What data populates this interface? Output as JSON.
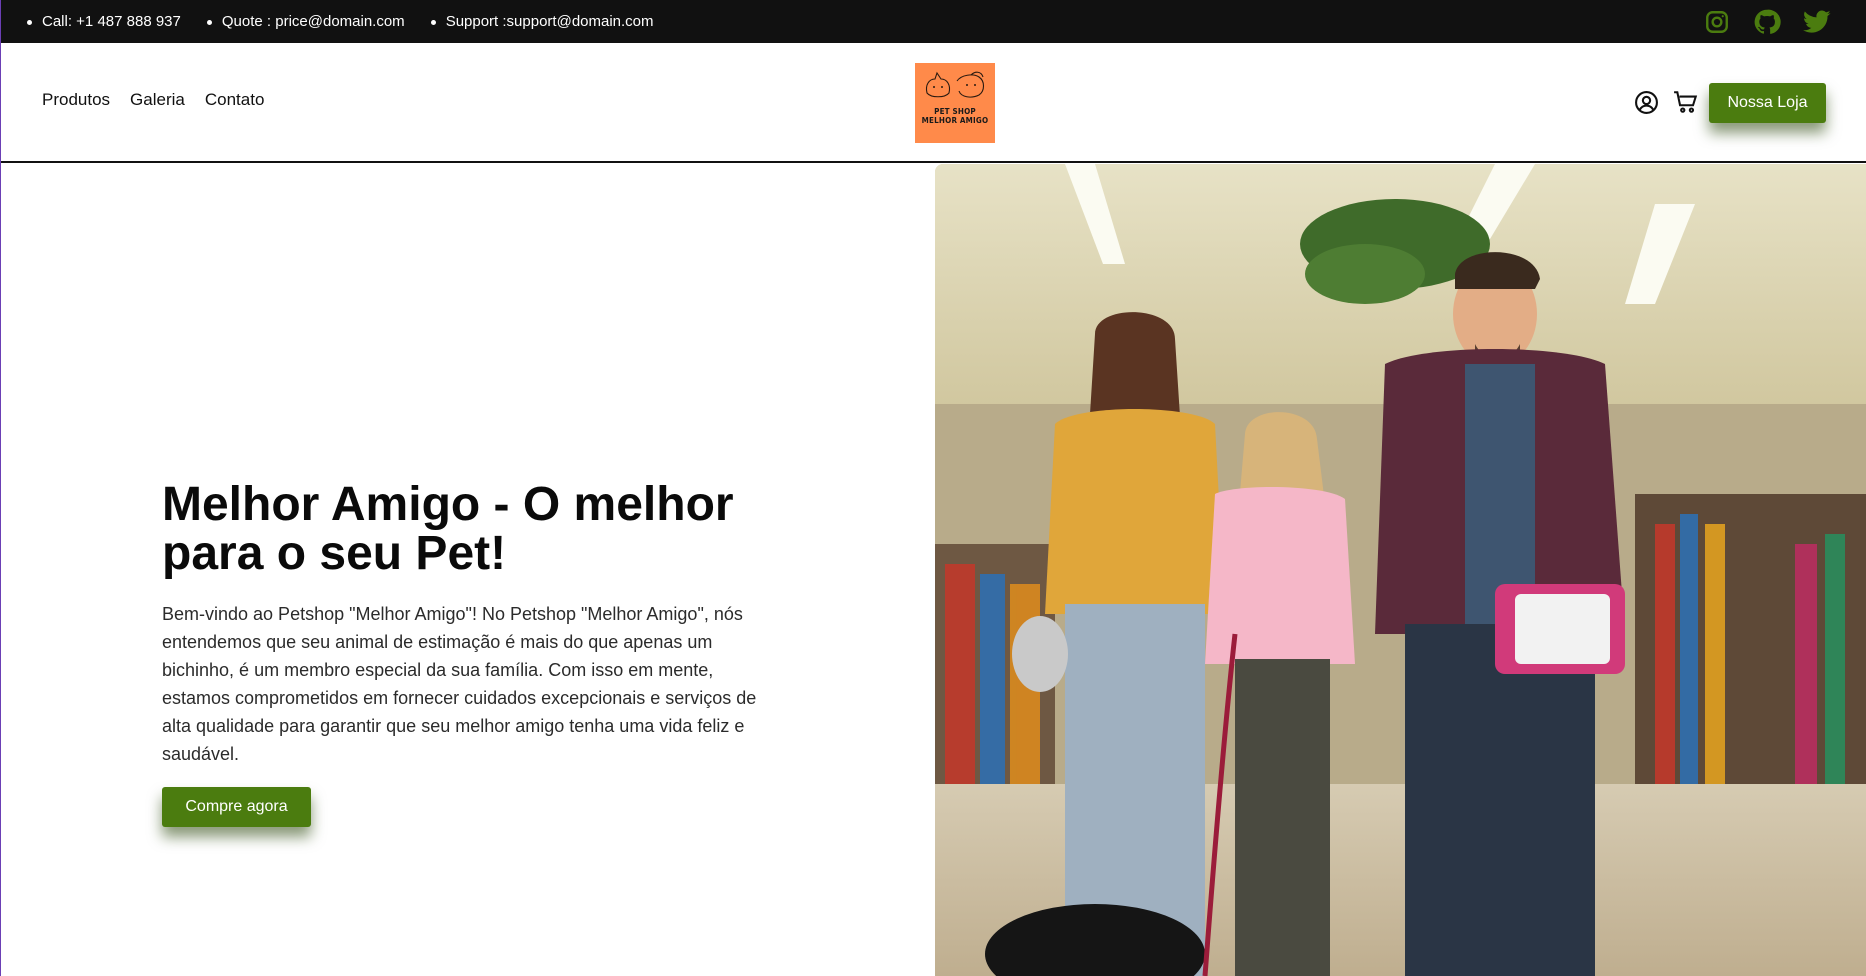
{
  "topbar": {
    "call": "Call: +1 487 888 937",
    "quote": "Quote : price@domain.com",
    "support": "Support :support@domain.com",
    "social": [
      "instagram-icon",
      "github-icon",
      "twitter-icon"
    ],
    "social_color": "#4b7c0f"
  },
  "nav": {
    "items": [
      "Produtos",
      "Galeria",
      "Contato"
    ]
  },
  "logo": {
    "line1": "PET SHOP",
    "line2": "MELHOR AMIGO",
    "bg_color": "#ff8a4a"
  },
  "header": {
    "store_button": "Nossa Loja",
    "icons": [
      "user-icon",
      "cart-icon"
    ]
  },
  "hero": {
    "title": "Melhor Amigo - O melhor para o seu Pet!",
    "text": "Bem-vindo ao Petshop \"Melhor Amigo\"! No Petshop \"Melhor Amigo\", nós entendemos que seu animal de estimação é mais do que apenas um bichinho, é um membro especial da sua família. Com isso em mente, estamos comprometidos em fornecer cuidados excepcionais e serviços de alta qualidade para garantir que seu melhor amigo tenha uma vida feliz e saudável.",
    "button": "Compre agora",
    "accent_color": "#4b7c0f"
  }
}
